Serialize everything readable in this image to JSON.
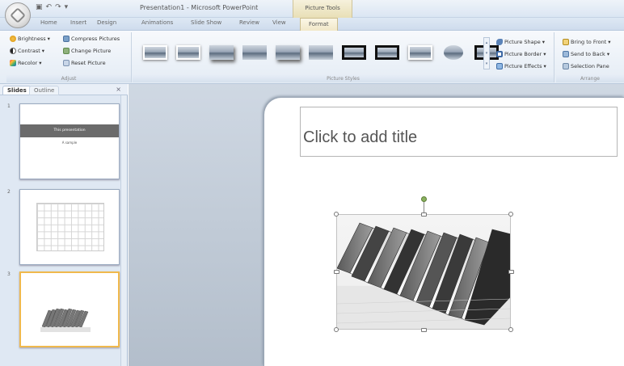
{
  "window": {
    "title": "Presentation1 - Microsoft PowerPoint",
    "contextual_tools": "Picture Tools"
  },
  "tabs": [
    "Home",
    "Insert",
    "Design",
    "Animations",
    "Slide Show",
    "Review",
    "View",
    "Format"
  ],
  "ribbon": {
    "adjust": {
      "label": "Adjust",
      "brightness": "Brightness",
      "contrast": "Contrast",
      "recolor": "Recolor",
      "compress": "Compress Pictures",
      "change": "Change Picture",
      "reset": "Reset Picture"
    },
    "picture_styles": {
      "label": "Picture Styles",
      "picture_shape": "Picture Shape",
      "picture_border": "Picture Border",
      "picture_effects": "Picture Effects"
    },
    "arrange": {
      "label": "Arrange",
      "bring_front": "Bring to Front",
      "send_back": "Send to Back",
      "selection_pane": "Selection Pane"
    }
  },
  "left_pane": {
    "tab_slides": "Slides",
    "tab_outline": "Outline",
    "close": "×",
    "slides": [
      {
        "number": "1",
        "title": "This presentation",
        "subtitle": "A sample"
      },
      {
        "number": "2"
      },
      {
        "number": "3"
      }
    ]
  },
  "slide": {
    "title_placeholder": "Click to add title"
  },
  "colors": {
    "ribbon_bg": "#e4ecf5",
    "contextual_tab": "#f1e8c8",
    "selected_thumb_border": "#f0b94d"
  }
}
